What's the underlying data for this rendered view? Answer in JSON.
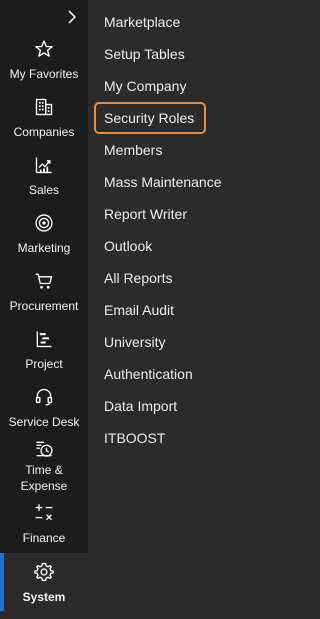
{
  "nav": {
    "collapse_icon": "chevron-right-icon",
    "items": [
      {
        "key": "my-favorites",
        "label": "My Favorites",
        "icon": "star-icon"
      },
      {
        "key": "companies",
        "label": "Companies",
        "icon": "building-icon"
      },
      {
        "key": "sales",
        "label": "Sales",
        "icon": "chart-up-icon"
      },
      {
        "key": "marketing",
        "label": "Marketing",
        "icon": "target-icon"
      },
      {
        "key": "procurement",
        "label": "Procurement",
        "icon": "cart-icon"
      },
      {
        "key": "project",
        "label": "Project",
        "icon": "project-icon"
      },
      {
        "key": "service-desk",
        "label": "Service Desk",
        "icon": "headset-icon"
      },
      {
        "key": "time-expense",
        "label": "Time &\nExpense",
        "icon": "time-expense-icon"
      },
      {
        "key": "finance",
        "label": "Finance",
        "icon": "calculator-icon"
      },
      {
        "key": "system",
        "label": "System",
        "icon": "gear-icon",
        "active": true
      }
    ]
  },
  "submenu": {
    "items": [
      {
        "label": "Marketplace"
      },
      {
        "label": "Setup Tables"
      },
      {
        "label": "My Company"
      },
      {
        "label": "Security Roles",
        "selected": true
      },
      {
        "label": "Members"
      },
      {
        "label": "Mass Maintenance"
      },
      {
        "label": "Report Writer"
      },
      {
        "label": "Outlook"
      },
      {
        "label": "All Reports"
      },
      {
        "label": "Email Audit"
      },
      {
        "label": "University"
      },
      {
        "label": "Authentication"
      },
      {
        "label": "Data Import"
      },
      {
        "label": "ITBOOST"
      }
    ]
  },
  "colors": {
    "rail_bg": "#1c1c1c",
    "panel_bg": "#2b2b2b",
    "active_bar": "#1f73d6",
    "selected_outline": "#f08c3a",
    "text": "#ececec"
  }
}
